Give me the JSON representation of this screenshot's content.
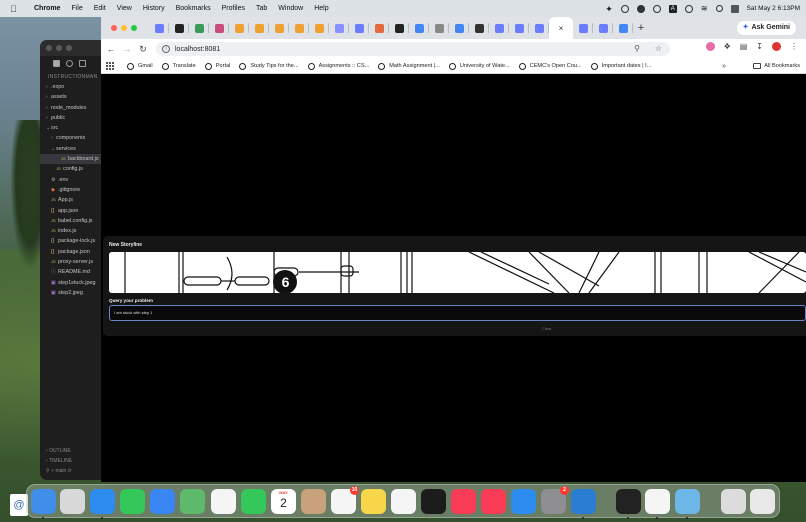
{
  "menubar": {
    "app": "Chrome",
    "items": [
      "File",
      "Edit",
      "View",
      "History",
      "Bookmarks",
      "Profiles",
      "Tab",
      "Window",
      "Help"
    ],
    "datetime": "Sat May 2  6:13PM"
  },
  "vscode": {
    "section": "INSTRUCTIONMAN",
    "files": [
      {
        "label": ".expo",
        "kind": "folder",
        "indent": 0
      },
      {
        "label": "assets",
        "kind": "folder",
        "indent": 0
      },
      {
        "label": "node_modules",
        "kind": "folder",
        "indent": 0
      },
      {
        "label": "public",
        "kind": "folder",
        "indent": 0
      },
      {
        "label": "src",
        "kind": "folder-open",
        "indent": 0
      },
      {
        "label": "components",
        "kind": "folder",
        "indent": 1
      },
      {
        "label": "services",
        "kind": "folder-open",
        "indent": 1
      },
      {
        "label": "backboard.js",
        "kind": "js",
        "indent": 2
      },
      {
        "label": "config.js",
        "kind": "js",
        "indent": 1
      },
      {
        "label": ".env",
        "kind": "env",
        "indent": 0
      },
      {
        "label": ".gitignore",
        "kind": "git",
        "indent": 0
      },
      {
        "label": "App.js",
        "kind": "js",
        "indent": 0
      },
      {
        "label": "app.json",
        "kind": "json",
        "indent": 0
      },
      {
        "label": "babel.config.js",
        "kind": "js",
        "indent": 0
      },
      {
        "label": "index.js",
        "kind": "js",
        "indent": 0
      },
      {
        "label": "package-lock.js",
        "kind": "json",
        "indent": 0
      },
      {
        "label": "package.json",
        "kind": "json",
        "indent": 0
      },
      {
        "label": "proxy-server.js",
        "kind": "js",
        "indent": 0
      },
      {
        "label": "README.md",
        "kind": "md",
        "indent": 0
      },
      {
        "label": "step1stuck.jpeg",
        "kind": "img",
        "indent": 0
      },
      {
        "label": "step2.jpeg",
        "kind": "img",
        "indent": 0
      }
    ],
    "outline": "OUTLINE",
    "timeline": "TIMELINE",
    "branch": "main"
  },
  "browser": {
    "url": "localhost:8081",
    "gemini": "Ask Gemini",
    "bookmarks": [
      "Gmail",
      "Translate",
      "Portal",
      "Study Tips for the...",
      "Assignments :: CS...",
      "Math Assignment |...",
      "University of Wate...",
      "CEMC's Open Cou...",
      "Important dates | I..."
    ],
    "all_bookmarks": "All Bookmarks",
    "tab_colors": [
      "#6b7cff",
      "#222",
      "#3a9a5c",
      "#cc4b7d",
      "#f0a030",
      "#f0a030",
      "#f0a030",
      "#f0a030",
      "#f0a030",
      "#8a8fff",
      "#6b7cff",
      "#e26a3b",
      "#222",
      "#4285f4",
      "#888",
      "#4285f4",
      "#333",
      "#6b7cff",
      "#6b7cff",
      "#6b7cff",
      "#6b7cff",
      "#6b7cff",
      "#4285f4"
    ]
  },
  "app": {
    "storyline_title": "New Storyline",
    "step_number": "6",
    "query_label": "Query your problem",
    "query_value": "I am stuck with step 1",
    "clear_label": "Clear"
  },
  "dock": {
    "calendar_month": "MAY",
    "calendar_day": "2",
    "reminders_badge": "10",
    "settings_badge": "2",
    "apps": [
      {
        "name": "finder",
        "color": "#3f8ee8"
      },
      {
        "name": "launchpad",
        "color": "#d8d8d8"
      },
      {
        "name": "safari",
        "color": "#2d8cf0"
      },
      {
        "name": "messages",
        "color": "#34c759"
      },
      {
        "name": "mail",
        "color": "#3a86f4"
      },
      {
        "name": "maps",
        "color": "#5fb96a"
      },
      {
        "name": "photos",
        "color": "#f5f5f5"
      },
      {
        "name": "facetime",
        "color": "#34c759"
      },
      {
        "name": "calendar",
        "color": "#ffffff"
      },
      {
        "name": "contacts",
        "color": "#c8a27a"
      },
      {
        "name": "reminders",
        "color": "#f5f5f5"
      },
      {
        "name": "notes",
        "color": "#f7d64a"
      },
      {
        "name": "freeform",
        "color": "#f5f5f5"
      },
      {
        "name": "tv",
        "color": "#1c1c1c"
      },
      {
        "name": "music",
        "color": "#fa3c57"
      },
      {
        "name": "news",
        "color": "#fa3c57"
      },
      {
        "name": "app-store",
        "color": "#2d8cf0"
      },
      {
        "name": "system-settings",
        "color": "#8e8e93"
      },
      {
        "name": "vscode",
        "color": "#2b7cd3"
      },
      {
        "name": "cursor",
        "color": "#222"
      },
      {
        "name": "chrome",
        "color": "#f5f5f5"
      },
      {
        "name": "preview",
        "color": "#6cb6e8"
      },
      {
        "name": "downloads",
        "color": "#dcdcdc"
      },
      {
        "name": "trash",
        "color": "#e8e8e8"
      }
    ]
  }
}
